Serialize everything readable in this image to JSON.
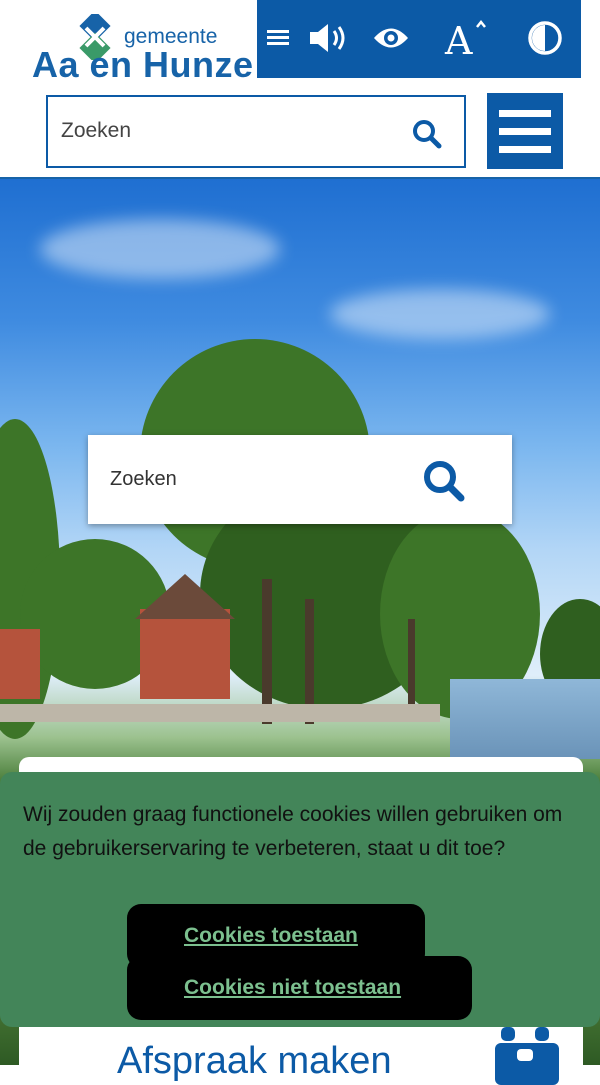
{
  "header": {
    "logo": {
      "small": "gemeente",
      "big": "Aa en Hunze"
    },
    "search_placeholder": "Zoeken",
    "colors": {
      "brand": "#0c5aa6",
      "logo_green": "#3a9a68"
    }
  },
  "accessibility_bar": {
    "icons": [
      "menu-lines-icon",
      "speaker-icon",
      "eye-icon",
      "text-size-icon",
      "contrast-icon"
    ]
  },
  "hero": {
    "search_placeholder": "Zoeken"
  },
  "card": {
    "title": "Afspraak maken"
  },
  "cookie_banner": {
    "message": "Wij zouden graag functionele cookies willen gebruiken om de gebruikerservaring te verbeteren, staat u dit toe?",
    "accept_label": "Cookies toestaan",
    "reject_label": "Cookies niet toestaan",
    "colors": {
      "background": "#438559",
      "button": "#000000",
      "link": "#7cc08f"
    }
  }
}
